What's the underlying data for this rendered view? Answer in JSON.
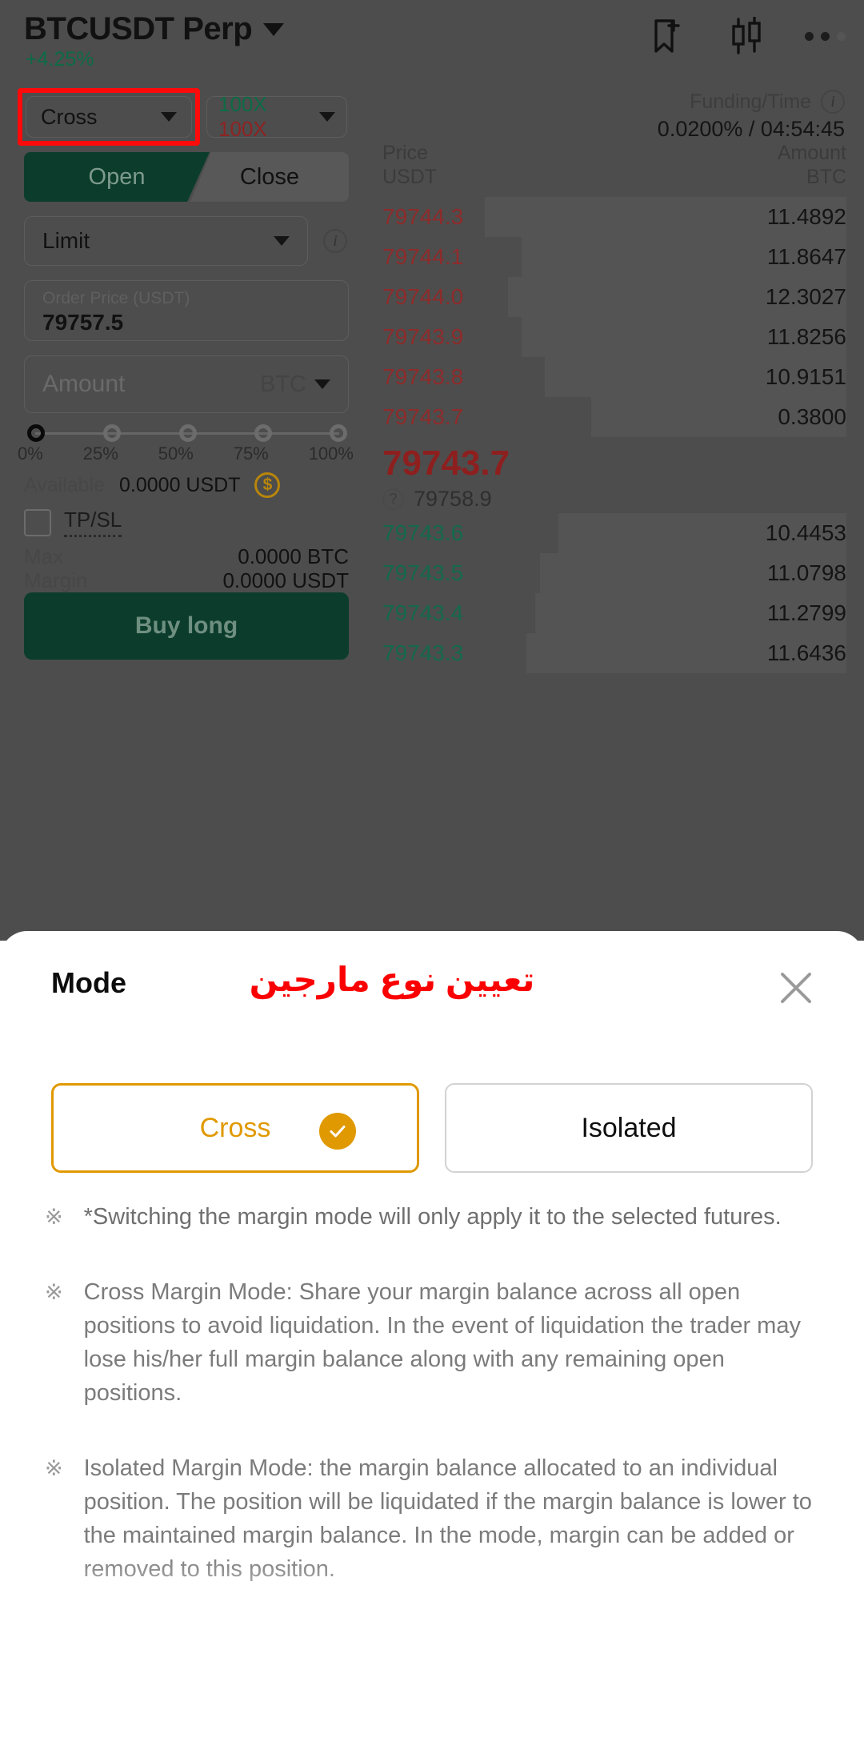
{
  "app": {
    "header": {
      "symbol": "BTCUSDT Perp",
      "change": "+4.25%",
      "icons": {
        "bookmark": "bookmark-add-icon",
        "chart": "candlestick-chart-icon",
        "more": "more-options-icon"
      }
    },
    "trade_panel": {
      "margin_mode": "Cross",
      "leverage_long": "100X",
      "leverage_short": "100X",
      "tab_open": "Open",
      "tab_close": "Close",
      "order_type": "Limit",
      "price_label": "Order Price (USDT)",
      "price_value": "79757.5",
      "amount_placeholder": "Amount",
      "amount_unit": "BTC",
      "slider_ticks": [
        "0%",
        "25%",
        "50%",
        "75%",
        "100%"
      ],
      "available_label": "Available",
      "available_value": "0.0000 USDT",
      "tpsl_label": "TP/SL",
      "max_label": "Max",
      "max_value": "0.0000 BTC",
      "margin_label": "Margin",
      "margin_value": "0.0000 USDT",
      "submit_label": "Buy long"
    },
    "order_book": {
      "funding_label": "Funding/Time",
      "funding_value": "0.0200% / 04:54:45",
      "col_price": "Price",
      "col_price_unit": "USDT",
      "col_amount": "Amount",
      "col_amount_unit": "BTC",
      "asks": [
        {
          "price": "79744.3",
          "amount": "11.4892",
          "depth": 78
        },
        {
          "price": "79744.1",
          "amount": "11.8647",
          "depth": 70
        },
        {
          "price": "79744.0",
          "amount": "12.3027",
          "depth": 73
        },
        {
          "price": "79743.9",
          "amount": "11.8256",
          "depth": 70
        },
        {
          "price": "79743.8",
          "amount": "10.9151",
          "depth": 65
        },
        {
          "price": "79743.7",
          "amount": "0.3800",
          "depth": 55
        }
      ],
      "last_price": "79743.7",
      "mark_price": "79758.9",
      "bids": [
        {
          "price": "79743.6",
          "amount": "10.4453",
          "depth": 62
        },
        {
          "price": "79743.5",
          "amount": "11.0798",
          "depth": 66
        },
        {
          "price": "79743.4",
          "amount": "11.2799",
          "depth": 67
        },
        {
          "price": "79743.3",
          "amount": "11.6436",
          "depth": 69
        }
      ]
    }
  },
  "sheet": {
    "title": "Mode",
    "annotation_fa": "تعیین نوع مارجین",
    "close_label": "close-icon",
    "options": [
      {
        "label": "Cross",
        "selected": true
      },
      {
        "label": "Isolated",
        "selected": false
      }
    ],
    "bullet": "※",
    "notes": [
      "*Switching the margin mode will only apply it to the selected futures.",
      "Cross Margin Mode: Share your margin balance across all open positions to avoid liquidation. In the event of liquidation the trader may lose his/her full margin balance along with any remaining open positions.",
      "Isolated Margin Mode: the margin balance allocated to an individual position. The position will be liquidated if the margin balance is lower to the maintained margin balance. In the mode, margin can be added or removed to this position."
    ]
  },
  "colors": {
    "accent_orange": "#e09900",
    "annotation_red": "#fb0000",
    "highlight_red": "#ff0a0a",
    "up_green": "#0c6b46",
    "down_red": "#8e2323"
  }
}
